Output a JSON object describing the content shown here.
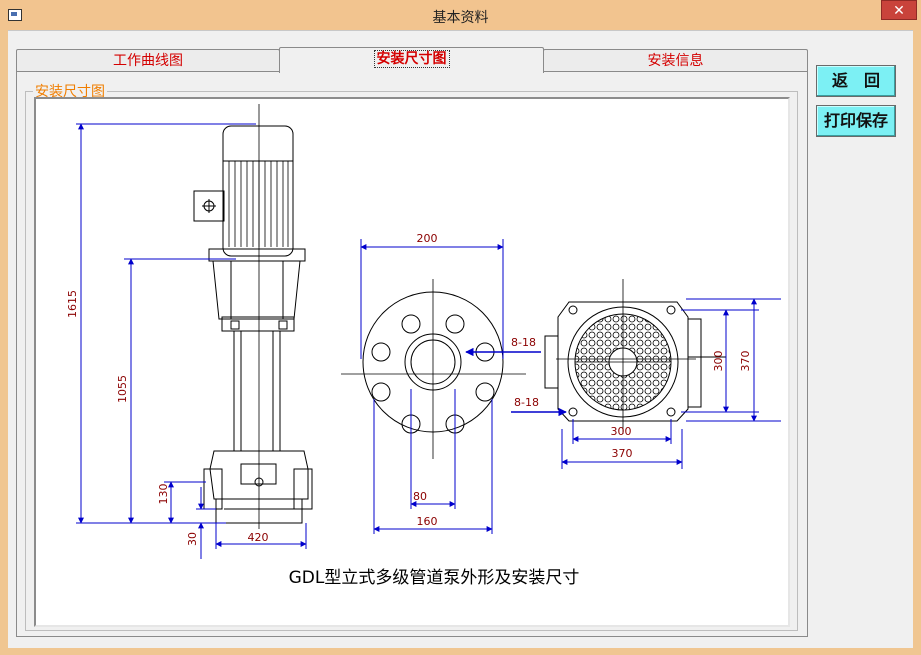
{
  "window": {
    "title": "基本资料",
    "close_glyph": "✕"
  },
  "tabs": [
    {
      "label": "工作曲线图",
      "active": false
    },
    {
      "label": "安装尺寸图",
      "active": true
    },
    {
      "label": "安装信息",
      "active": false
    }
  ],
  "group": {
    "label": "安装尺寸图"
  },
  "drawing": {
    "caption": "GDL型立式多级管道泵外形及安装尺寸",
    "dimensions": {
      "total_height": "1615",
      "flange_height": "1055",
      "base_height": "130",
      "base_offset": "30",
      "base_width": "420",
      "flange_outer": "200",
      "flange_inner": "80",
      "flange_pcd": "160",
      "holes_a": "8-18",
      "holes_b": "8-18",
      "base_inner_h": "300",
      "base_outer_h": "370",
      "base_inner_w": "300",
      "base_outer_w": "370"
    }
  },
  "buttons": {
    "back": "返　回",
    "print_save": "打印保存"
  },
  "colors": {
    "dimension": "#0000cc",
    "dim_text": "#8b0000",
    "line": "#000000",
    "group_label": "#f07e00",
    "tab_text": "#d40000",
    "button_bg": "#7cf0f4"
  }
}
